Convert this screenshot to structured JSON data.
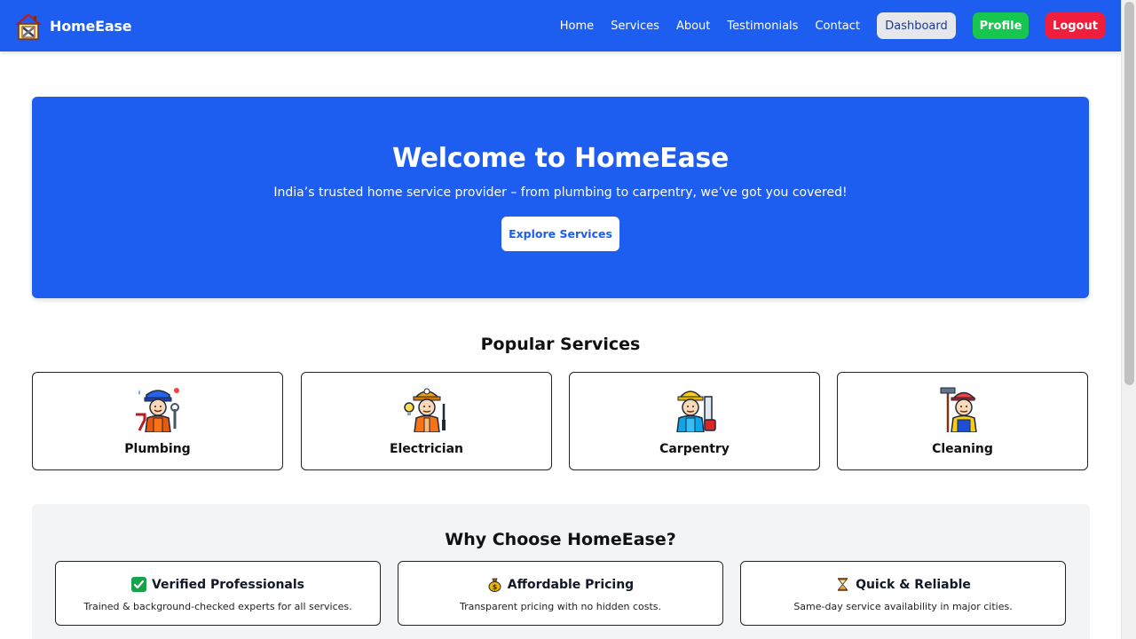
{
  "nav": {
    "brand": "HomeEase",
    "links": [
      "Home",
      "Services",
      "About",
      "Testimonials",
      "Contact"
    ],
    "dashboard_label": "Dashboard",
    "profile_label": "Profile",
    "logout_label": "Logout"
  },
  "hero": {
    "title": "Welcome to HomeEase",
    "subtitle": "India’s trusted home service provider – from plumbing to carpentry, we’ve got you covered!",
    "cta_label": "Explore Services"
  },
  "services": {
    "title": "Popular Services",
    "items": [
      {
        "label": "Plumbing",
        "icon": "plumber-icon"
      },
      {
        "label": "Electrician",
        "icon": "electrician-icon"
      },
      {
        "label": "Carpentry",
        "icon": "carpenter-icon"
      },
      {
        "label": "Cleaning",
        "icon": "cleaner-icon"
      }
    ]
  },
  "why": {
    "title": "Why Choose HomeEase?",
    "items": [
      {
        "icon": "check-mark-icon",
        "title": "Verified Professionals",
        "desc": "Trained & background-checked experts for all services."
      },
      {
        "icon": "money-bag-icon",
        "title": "Affordable Pricing",
        "desc": "Transparent pricing with no hidden costs."
      },
      {
        "icon": "hourglass-icon",
        "title": "Quick & Reliable",
        "desc": "Same-day service availability in major cities."
      }
    ]
  },
  "colors": {
    "primary": "#1d5ef0",
    "profile": "#16c64e",
    "logout": "#ef1e3c"
  }
}
